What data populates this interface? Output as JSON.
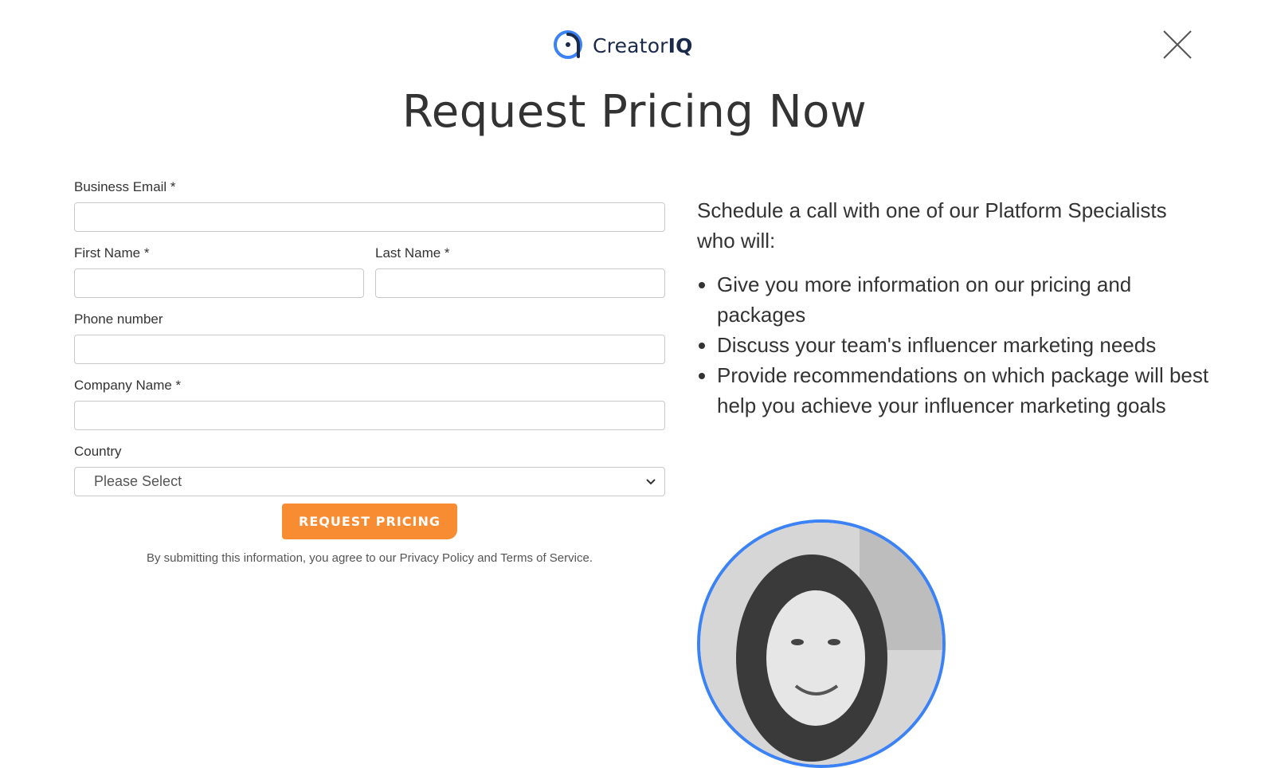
{
  "brand": {
    "name_regular": "Creator",
    "name_bold": "IQ",
    "accent_color": "#3b82f6",
    "text_color": "#1b2a4a"
  },
  "close_icon": "close-icon",
  "page_title": "Request Pricing Now",
  "form": {
    "email": {
      "label": "Business Email *",
      "value": "",
      "placeholder": ""
    },
    "first_name": {
      "label": "First Name *",
      "value": "",
      "placeholder": ""
    },
    "last_name": {
      "label": "Last Name *",
      "value": "",
      "placeholder": ""
    },
    "phone": {
      "label": "Phone number",
      "value": "",
      "placeholder": ""
    },
    "company": {
      "label": "Company Name *",
      "value": "",
      "placeholder": ""
    },
    "country": {
      "label": "Country",
      "selected": "Please Select"
    },
    "submit_label": "REQUEST PRICING",
    "submit_color": "#f88c33"
  },
  "legal": {
    "prefix": "By submitting this information, you agree to our ",
    "privacy": "Privacy Policy",
    "middle": " and ",
    "terms": "Terms of Service",
    "suffix": "."
  },
  "info": {
    "intro": "Schedule a call with one of our Platform Specialists who will:",
    "bullets": [
      "Give you more information on our pricing and packages",
      "Discuss your team's influencer marketing needs",
      "Provide recommendations on which package will best help you achieve your influencer marketing goals"
    ]
  }
}
